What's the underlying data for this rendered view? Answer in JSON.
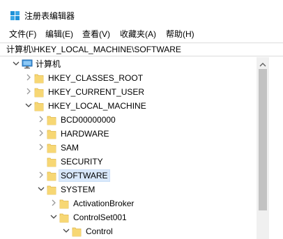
{
  "window": {
    "title": "注册表编辑器",
    "icon": "regedit-icon"
  },
  "menu": [
    {
      "label": "文件(F)"
    },
    {
      "label": "编辑(E)"
    },
    {
      "label": "查看(V)"
    },
    {
      "label": "收藏夹(A)"
    },
    {
      "label": "帮助(H)"
    }
  ],
  "address": {
    "path": "计算机\\HKEY_LOCAL_MACHINE\\SOFTWARE"
  },
  "tree": [
    {
      "label": "计算机",
      "level": 0,
      "expander": "expanded",
      "icon": "computer-icon"
    },
    {
      "label": "HKEY_CLASSES_ROOT",
      "level": 1,
      "expander": "collapsed",
      "icon": "folder-icon"
    },
    {
      "label": "HKEY_CURRENT_USER",
      "level": 1,
      "expander": "collapsed",
      "icon": "folder-icon"
    },
    {
      "label": "HKEY_LOCAL_MACHINE",
      "level": 1,
      "expander": "expanded",
      "icon": "folder-icon"
    },
    {
      "label": "BCD00000000",
      "level": 2,
      "expander": "collapsed",
      "icon": "folder-icon"
    },
    {
      "label": "HARDWARE",
      "level": 2,
      "expander": "collapsed",
      "icon": "folder-icon"
    },
    {
      "label": "SAM",
      "level": 2,
      "expander": "collapsed",
      "icon": "folder-icon"
    },
    {
      "label": "SECURITY",
      "level": 2,
      "expander": "none",
      "icon": "folder-icon"
    },
    {
      "label": "SOFTWARE",
      "level": 2,
      "expander": "collapsed",
      "icon": "folder-icon",
      "selected": true
    },
    {
      "label": "SYSTEM",
      "level": 2,
      "expander": "expanded",
      "icon": "folder-icon"
    },
    {
      "label": "ActivationBroker",
      "level": 3,
      "expander": "collapsed",
      "icon": "folder-icon"
    },
    {
      "label": "ControlSet001",
      "level": 3,
      "expander": "expanded",
      "icon": "folder-icon"
    },
    {
      "label": "Control",
      "level": 4,
      "expander": "expanded",
      "icon": "folder-icon"
    }
  ],
  "colors": {
    "folder": "#f7d774",
    "folder_edge": "#e0b84a",
    "selection": "#d9e8fb",
    "scroll_thumb": "#c2c2c2"
  }
}
